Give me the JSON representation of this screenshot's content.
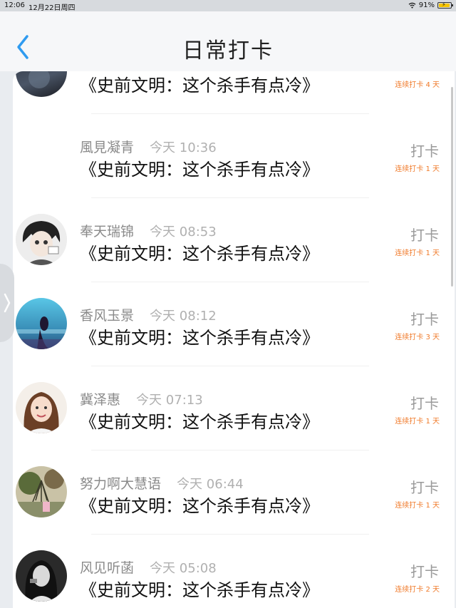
{
  "status_bar": {
    "time": "12:06",
    "date": "12月22日周四",
    "battery": "91%"
  },
  "nav": {
    "title": "日常打卡"
  },
  "records": [
    {
      "name": "",
      "time": "",
      "book": "《史前文明：这个杀手有点冷》",
      "action": "",
      "streak": "连续打卡 4 天"
    },
    {
      "name": "風見凝青",
      "time": "今天 10:36",
      "book": "《史前文明：这个杀手有点冷》",
      "action": "打卡",
      "streak": "连续打卡 1 天"
    },
    {
      "name": "奉天瑞锦",
      "time": "今天 08:53",
      "book": "《史前文明：这个杀手有点冷》",
      "action": "打卡",
      "streak": "连续打卡 1 天"
    },
    {
      "name": "香风玉景",
      "time": "今天 08:12",
      "book": "《史前文明：这个杀手有点冷》",
      "action": "打卡",
      "streak": "连续打卡 3 天"
    },
    {
      "name": "冀泽惠",
      "time": "今天 07:13",
      "book": "《史前文明：这个杀手有点冷》",
      "action": "打卡",
      "streak": "连续打卡 1 天"
    },
    {
      "name": "努力啊大慧语",
      "time": "今天 06:44",
      "book": "《史前文明：这个杀手有点冷》",
      "action": "打卡",
      "streak": "连续打卡 1 天"
    },
    {
      "name": "风见听菡",
      "time": "今天 05:08",
      "book": "《史前文明：这个杀手有点冷》",
      "action": "打卡",
      "streak": "连续打卡 2 天"
    }
  ],
  "colors": {
    "accent": "#2f9bf0",
    "streak": "#f07a2a"
  }
}
